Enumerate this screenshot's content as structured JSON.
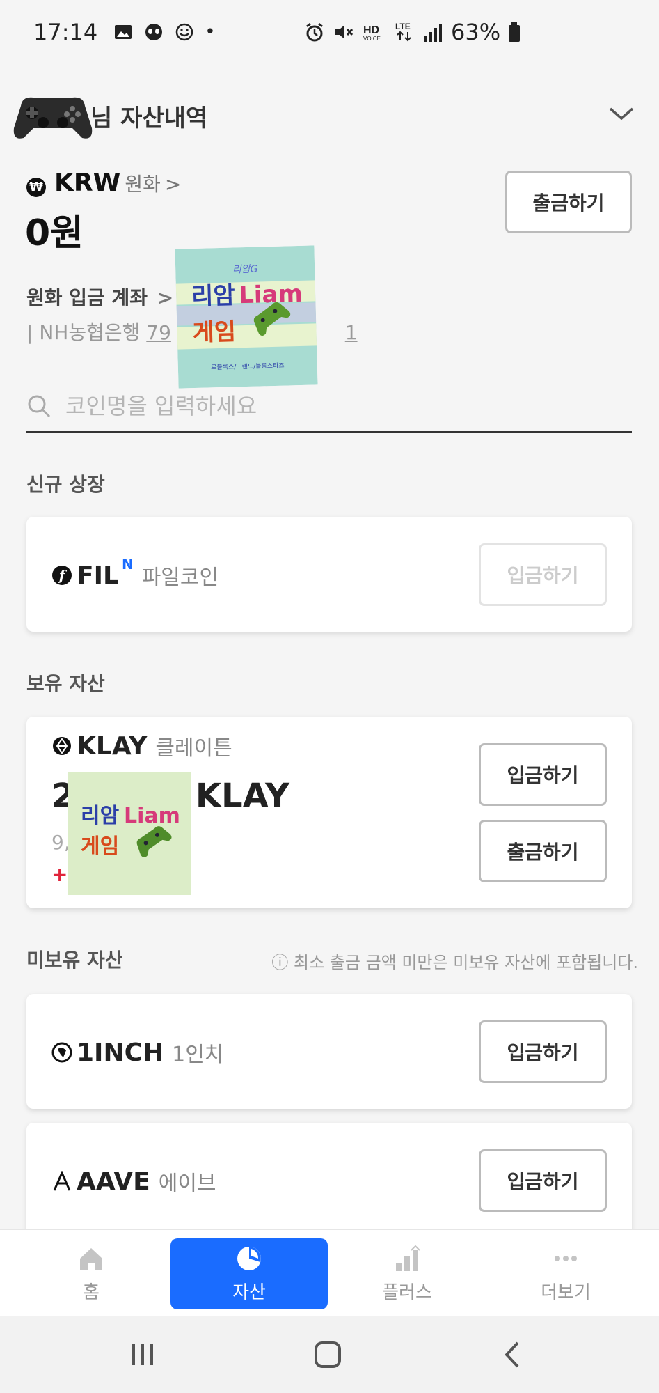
{
  "status_bar": {
    "time": "17:14",
    "dot": "•",
    "battery": "63%",
    "icons": [
      "image-icon",
      "alien-icon",
      "smile-icon",
      "alarm-icon",
      "mute-icon",
      "hd-voice-icon",
      "lte-icon",
      "signal-icon",
      "battery-icon"
    ]
  },
  "header": {
    "title": "님 자산내역",
    "overlay": "game-controller-icon"
  },
  "krw": {
    "symbol": "KRW",
    "name": "원화",
    "arrow": ">",
    "balance": "0원",
    "withdraw_label": "출금하기",
    "badge": "₩"
  },
  "deposit_account": {
    "label": "원화 입금 계좌",
    "arrow": ">",
    "bank": "| NH농협은행",
    "number_visible_start": "79",
    "number_visible_end": "1"
  },
  "sticker": {
    "top_small": "리암G",
    "line1_kor": "리암",
    "line1_eng": "Liam",
    "line2": "게임",
    "footer": "로블록스/ㆍ랜드/블롬스타즈"
  },
  "search": {
    "placeholder": "코인명을 입력하세요"
  },
  "sections": {
    "new_listing": "신규 상장",
    "holding": "보유 자산",
    "not_holding": "미보유 자산",
    "not_holding_note": "ⓘ 최소 출금 금액 미만은 미보유 자산에 포함됩니다."
  },
  "new_listing": [
    {
      "ticker": "FIL",
      "badge": "N",
      "name": "파일코인",
      "logo_char": "f",
      "deposit_label": "입금하기",
      "disabled": true
    }
  ],
  "holding": [
    {
      "ticker": "KLAY",
      "name": "클레이튼",
      "amount_prefix": "2",
      "amount_suffix": "KLAY",
      "krw_visible": "9,",
      "change_visible": "+",
      "deposit_label": "입금하기",
      "withdraw_label": "출금하기"
    }
  ],
  "not_holding": [
    {
      "ticker": "1INCH",
      "name": "1인치",
      "deposit_label": "입금하기"
    },
    {
      "ticker": "AAVE",
      "name": "에이브",
      "deposit_label": "입금하기"
    }
  ],
  "tabs": [
    {
      "label": "홈",
      "icon": "home-icon",
      "active": false
    },
    {
      "label": "자산",
      "icon": "pie-chart-icon",
      "active": true
    },
    {
      "label": "플러스",
      "icon": "bar-chart-icon",
      "active": false
    },
    {
      "label": "더보기",
      "icon": "more-icon",
      "active": false
    }
  ],
  "colors": {
    "accent": "#1a6cff",
    "positive_change": "#e0243b",
    "background": "#f5f5f5"
  }
}
